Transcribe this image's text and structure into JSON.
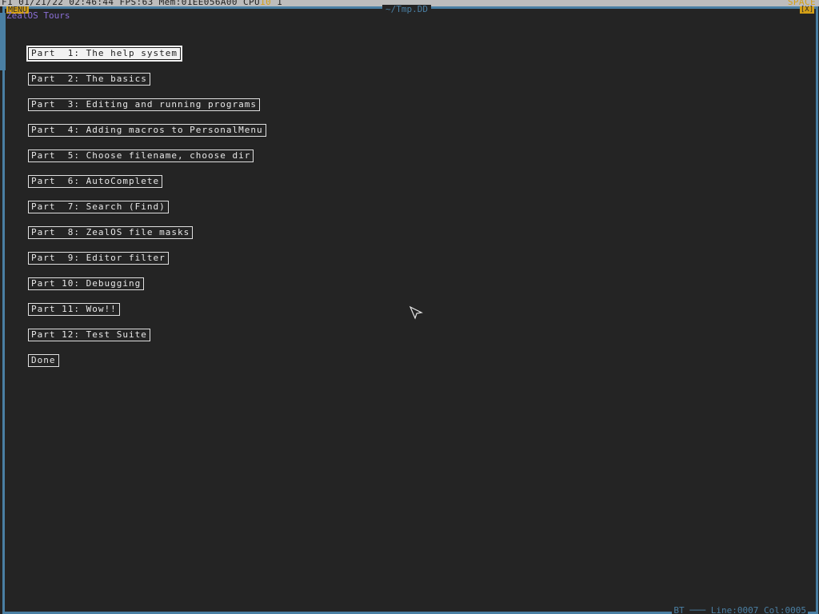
{
  "status_bar": {
    "left_text": "F1 01/21/22 02:46:44 FPS:63 Mem:01EE056A00 CPU",
    "cpu_level": "10",
    "cpu_extra": " 1",
    "right_text": "SPACE"
  },
  "window": {
    "menu_label": "MENU",
    "title": "~/Tmp.DD",
    "close_label": "[X]",
    "app_title": "ZealOS Tours"
  },
  "tours": [
    {
      "label": "Part  1: The help system",
      "selected": true
    },
    {
      "label": "Part  2: The basics"
    },
    {
      "label": "Part  3: Editing and running programs"
    },
    {
      "label": "Part  4: Adding macros to PersonalMenu"
    },
    {
      "label": "Part  5: Choose filename, choose dir"
    },
    {
      "label": "Part  6: AutoComplete"
    },
    {
      "label": "Part  7: Search (Find)"
    },
    {
      "label": "Part  8: ZealOS file masks"
    },
    {
      "label": "Part  9: Editor filter"
    },
    {
      "label": "Part 10: Debugging"
    },
    {
      "label": "Part 11: Wow!!"
    },
    {
      "label": "Part 12: Test Suite"
    },
    {
      "label": "Done"
    }
  ],
  "bottom_bar": {
    "mode": "BT",
    "line": "Line:0007",
    "col": "Col:0005"
  },
  "colors": {
    "background": "#242424",
    "frame": "#4a7fa3",
    "accent": "#d4a017",
    "title_purple": "#8b6fd6",
    "button_border": "#e0e0e0"
  },
  "icons": {
    "cursor": "mouse-pointer-icon"
  }
}
